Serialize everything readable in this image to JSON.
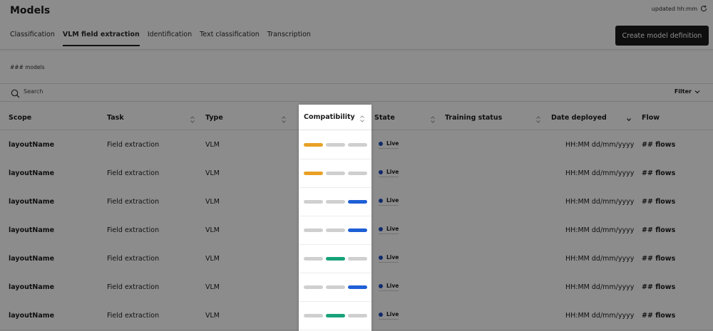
{
  "header": {
    "title": "Models",
    "updated": "updated hh:mm",
    "tabs": [
      {
        "label": "Classification",
        "active": false
      },
      {
        "label": "VLM field extraction",
        "active": true
      },
      {
        "label": "Identification",
        "active": false
      },
      {
        "label": "Text classification",
        "active": false
      },
      {
        "label": "Transcription",
        "active": false
      }
    ],
    "create_button": "Create model definition"
  },
  "model_count": "### models",
  "search": {
    "placeholder": "Search",
    "filter_label": "Filter"
  },
  "table": {
    "columns": [
      "Scope",
      "Task",
      "Type",
      "Compatibility",
      "State",
      "Training status",
      "Date deployed",
      "Flow"
    ],
    "rows": [
      {
        "scope": "layoutName",
        "task": "Field extraction",
        "type": "VLM",
        "compatibility": [
          "orange",
          "gray",
          "gray"
        ],
        "state": "Live",
        "date": "HH:MM dd/mm/yyyy",
        "flow": "## flows"
      },
      {
        "scope": "layoutName",
        "task": "Field extraction",
        "type": "VLM",
        "compatibility": [
          "orange",
          "gray",
          "gray"
        ],
        "state": "Live",
        "date": "HH:MM dd/mm/yyyy",
        "flow": "## flows"
      },
      {
        "scope": "layoutName",
        "task": "Field extraction",
        "type": "VLM",
        "compatibility": [
          "gray",
          "gray",
          "blue"
        ],
        "state": "Live",
        "date": "HH:MM dd/mm/yyyy",
        "flow": "## flows"
      },
      {
        "scope": "layoutName",
        "task": "Field extraction",
        "type": "VLM",
        "compatibility": [
          "gray",
          "gray",
          "blue"
        ],
        "state": "Live",
        "date": "HH:MM dd/mm/yyyy",
        "flow": "## flows"
      },
      {
        "scope": "layoutName",
        "task": "Field extraction",
        "type": "VLM",
        "compatibility": [
          "gray",
          "green",
          "gray"
        ],
        "state": "Live",
        "date": "HH:MM dd/mm/yyyy",
        "flow": "## flows"
      },
      {
        "scope": "layoutName",
        "task": "Field extraction",
        "type": "VLM",
        "compatibility": [
          "gray",
          "gray",
          "blue"
        ],
        "state": "Live",
        "date": "HH:MM dd/mm/yyyy",
        "flow": "## flows"
      },
      {
        "scope": "layoutName",
        "task": "Field extraction",
        "type": "VLM",
        "compatibility": [
          "gray",
          "green",
          "gray"
        ],
        "state": "Live",
        "date": "HH:MM dd/mm/yyyy",
        "flow": "## flows"
      }
    ]
  },
  "colors": {
    "orange": "#e8a026",
    "gray": "#cfcfcf",
    "blue": "#1f5fd6",
    "green": "#17a27a",
    "live_dot": "#1f4fc2"
  }
}
